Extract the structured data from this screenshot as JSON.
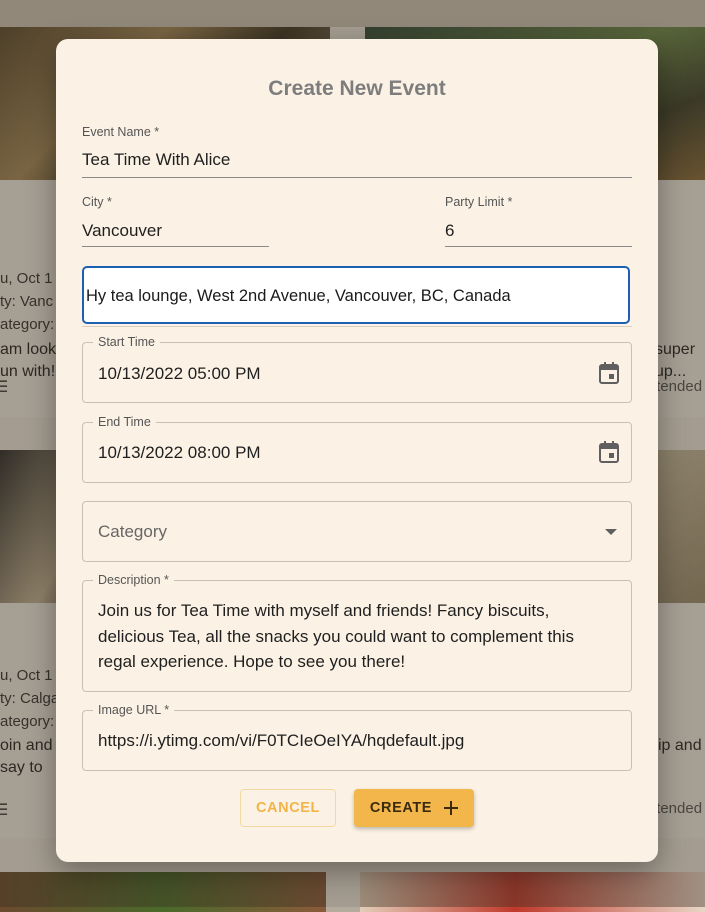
{
  "background": {
    "card_left_top": {
      "date_text": "u, Oct 1",
      "city_text": "ty: Vanc",
      "category_text": "ategory:",
      "body_lines": [
        "am look",
        "un with!"
      ]
    },
    "card_right_top": {
      "body_lines": [
        "super",
        "up..."
      ],
      "attended_text": "ttended"
    },
    "card_left_mid": {
      "date_text": "u, Oct 1",
      "city_text": "ty: Calga",
      "category_text": "ategory:",
      "body_lines": [
        "oin and",
        "say to"
      ]
    },
    "card_right_mid": {
      "body_lines": [
        "ip and"
      ],
      "attended_text": "ttended"
    },
    "menu_glyph": "☰"
  },
  "dialog": {
    "title": "Create New Event",
    "fields": {
      "event_name": {
        "label": "Event Name *",
        "value": "Tea Time With Alice"
      },
      "city": {
        "label": "City *",
        "value": "Vancouver"
      },
      "party_limit": {
        "label": "Party Limit *",
        "value": "6"
      },
      "address": {
        "value": "Hy tea lounge, West 2nd Avenue, Vancouver, BC, Canada"
      },
      "start_time": {
        "label": "Start Time",
        "value": "10/13/2022 05:00 PM"
      },
      "end_time": {
        "label": "End Time",
        "value": "10/13/2022 08:00 PM"
      },
      "category": {
        "placeholder": "Category"
      },
      "description": {
        "label": "Description *",
        "value": "Join us for Tea Time with myself and friends! Fancy biscuits, delicious Tea, all the snacks you could want to complement this regal experience. Hope to see you there!"
      },
      "image_url": {
        "label": "Image URL *",
        "value": "https://i.ytimg.com/vi/F0TCIeOeIYA/hqdefault.jpg"
      }
    },
    "buttons": {
      "cancel": "CANCEL",
      "create": "CREATE"
    },
    "icons": {
      "calendar": "calendar-icon",
      "dropdown": "dropdown-arrow-icon",
      "plus": "plus-icon"
    },
    "colors": {
      "dialog_bg": "#fbf2e5",
      "focus_border": "#1d5fb0",
      "accent": "#f3b64a"
    }
  }
}
